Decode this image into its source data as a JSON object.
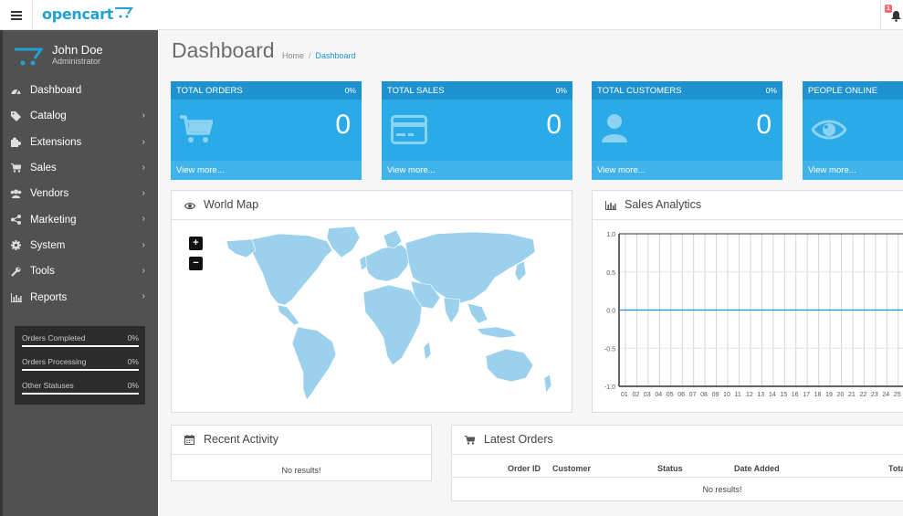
{
  "header": {
    "logo_text": "opencart",
    "notification_count": "1"
  },
  "user": {
    "name": "John Doe",
    "role": "Administrator"
  },
  "menu": [
    {
      "label": "Dashboard",
      "icon": "dashboard-icon",
      "has_children": false
    },
    {
      "label": "Catalog",
      "icon": "tag-icon",
      "has_children": true
    },
    {
      "label": "Extensions",
      "icon": "puzzle-icon",
      "has_children": true
    },
    {
      "label": "Sales",
      "icon": "cart-icon",
      "has_children": true
    },
    {
      "label": "Vendors",
      "icon": "users-icon",
      "has_children": true
    },
    {
      "label": "Marketing",
      "icon": "share-icon",
      "has_children": true
    },
    {
      "label": "System",
      "icon": "cog-icon",
      "has_children": true
    },
    {
      "label": "Tools",
      "icon": "wrench-icon",
      "has_children": true
    },
    {
      "label": "Reports",
      "icon": "bar-chart-icon",
      "has_children": true
    }
  ],
  "order_stats": [
    {
      "label": "Orders Completed",
      "percent": "0%"
    },
    {
      "label": "Orders Processing",
      "percent": "0%"
    },
    {
      "label": "Other Statuses",
      "percent": "0%"
    }
  ],
  "page": {
    "title": "Dashboard",
    "breadcrumb": [
      "Home",
      "Dashboard"
    ]
  },
  "tiles": [
    {
      "title": "TOTAL ORDERS",
      "percent": "0%",
      "value": "0",
      "link": "View more...",
      "icon": "shopping-cart-icon"
    },
    {
      "title": "TOTAL SALES",
      "percent": "0%",
      "value": "0",
      "link": "View more...",
      "icon": "credit-card-icon"
    },
    {
      "title": "TOTAL CUSTOMERS",
      "percent": "0%",
      "value": "0",
      "link": "View more...",
      "icon": "user-icon"
    },
    {
      "title": "PEOPLE ONLINE",
      "percent": "",
      "value": "",
      "link": "View more...",
      "icon": "eye-icon"
    }
  ],
  "world_map": {
    "title": "World Map",
    "zoom_in": "+",
    "zoom_out": "−"
  },
  "sales_analytics": {
    "title": "Sales Analytics"
  },
  "recent_activity": {
    "title": "Recent Activity",
    "empty": "No results!"
  },
  "latest_orders": {
    "title": "Latest Orders",
    "columns": [
      "Order ID",
      "Customer",
      "Status",
      "Date Added",
      "Total"
    ],
    "empty": "No results!"
  },
  "colors": {
    "accent": "#1e91cf",
    "tile": "#2aaae6",
    "sidebar": "#515151",
    "map": "#9cd1ee"
  },
  "chart_data": {
    "type": "line",
    "x": [
      "01",
      "02",
      "03",
      "04",
      "05",
      "06",
      "07",
      "08",
      "09",
      "10",
      "11",
      "12",
      "13",
      "14",
      "15",
      "16",
      "17",
      "18",
      "19",
      "20",
      "21",
      "22",
      "23",
      "24",
      "25"
    ],
    "series": [
      {
        "values": [
          0,
          0,
          0,
          0,
          0,
          0,
          0,
          0,
          0,
          0,
          0,
          0,
          0,
          0,
          0,
          0,
          0,
          0,
          0,
          0,
          0,
          0,
          0,
          0,
          0
        ]
      }
    ],
    "yticks": [
      "1.0",
      "0.5",
      "0.0",
      "-0.5",
      "-1.0"
    ],
    "ylim": [
      -1,
      1
    ],
    "grid": true
  }
}
